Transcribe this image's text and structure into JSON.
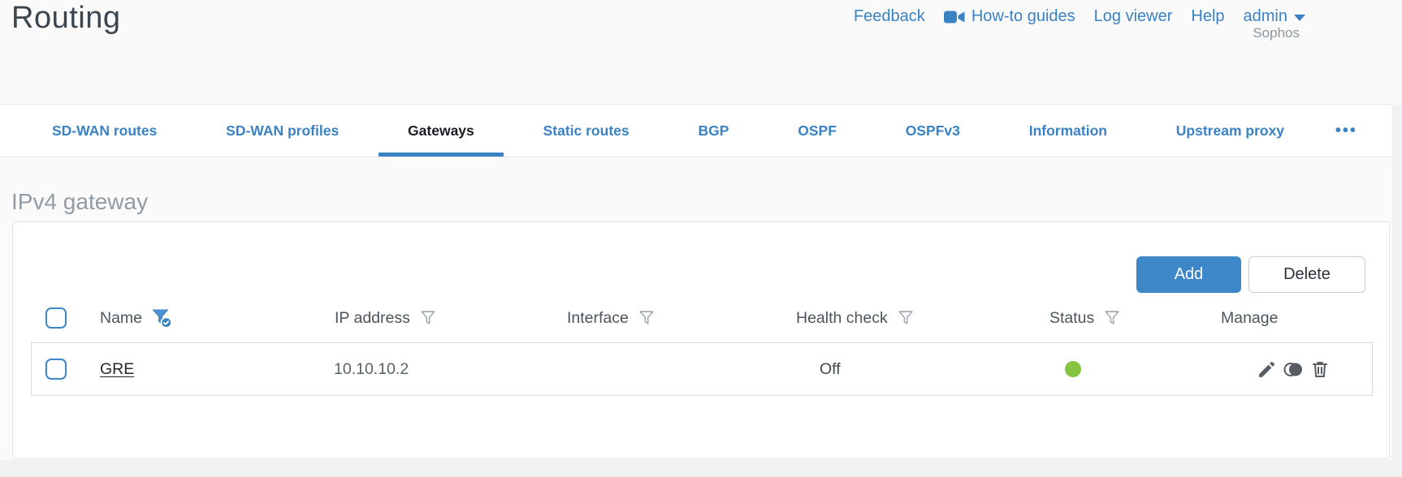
{
  "page": {
    "title": "Routing"
  },
  "header": {
    "links": {
      "feedback": "Feedback",
      "howto": "How-to guides",
      "log_viewer": "Log viewer",
      "help": "Help"
    },
    "user": "admin",
    "brand": "Sophos"
  },
  "tabs": [
    {
      "label": "SD-WAN routes",
      "active": false
    },
    {
      "label": "SD-WAN profiles",
      "active": false
    },
    {
      "label": "Gateways",
      "active": true
    },
    {
      "label": "Static routes",
      "active": false
    },
    {
      "label": "BGP",
      "active": false
    },
    {
      "label": "OSPF",
      "active": false
    },
    {
      "label": "OSPFv3",
      "active": false
    },
    {
      "label": "Information",
      "active": false
    },
    {
      "label": "Upstream proxy",
      "active": false
    },
    {
      "label": "•••",
      "active": false
    }
  ],
  "section": {
    "title": "IPv4 gateway"
  },
  "toolbar": {
    "add": "Add",
    "delete": "Delete"
  },
  "table": {
    "columns": [
      {
        "key": "name",
        "label": "Name",
        "filter": "active"
      },
      {
        "key": "ip",
        "label": "IP address",
        "filter": "default"
      },
      {
        "key": "interface",
        "label": "Interface",
        "filter": "default"
      },
      {
        "key": "health",
        "label": "Health check",
        "filter": "default"
      },
      {
        "key": "status",
        "label": "Status",
        "filter": "default"
      },
      {
        "key": "manage",
        "label": "Manage",
        "filter": "none"
      }
    ],
    "rows": [
      {
        "name": "GRE",
        "ip": "10.10.10.2",
        "interface": "",
        "health_check": "Off",
        "status": "up"
      }
    ]
  },
  "colors": {
    "accent_blue": "#3a82c4",
    "add_button_blue": "#3d87c9",
    "status_green": "#85c441",
    "active_tab_text": "#1a1e22"
  }
}
